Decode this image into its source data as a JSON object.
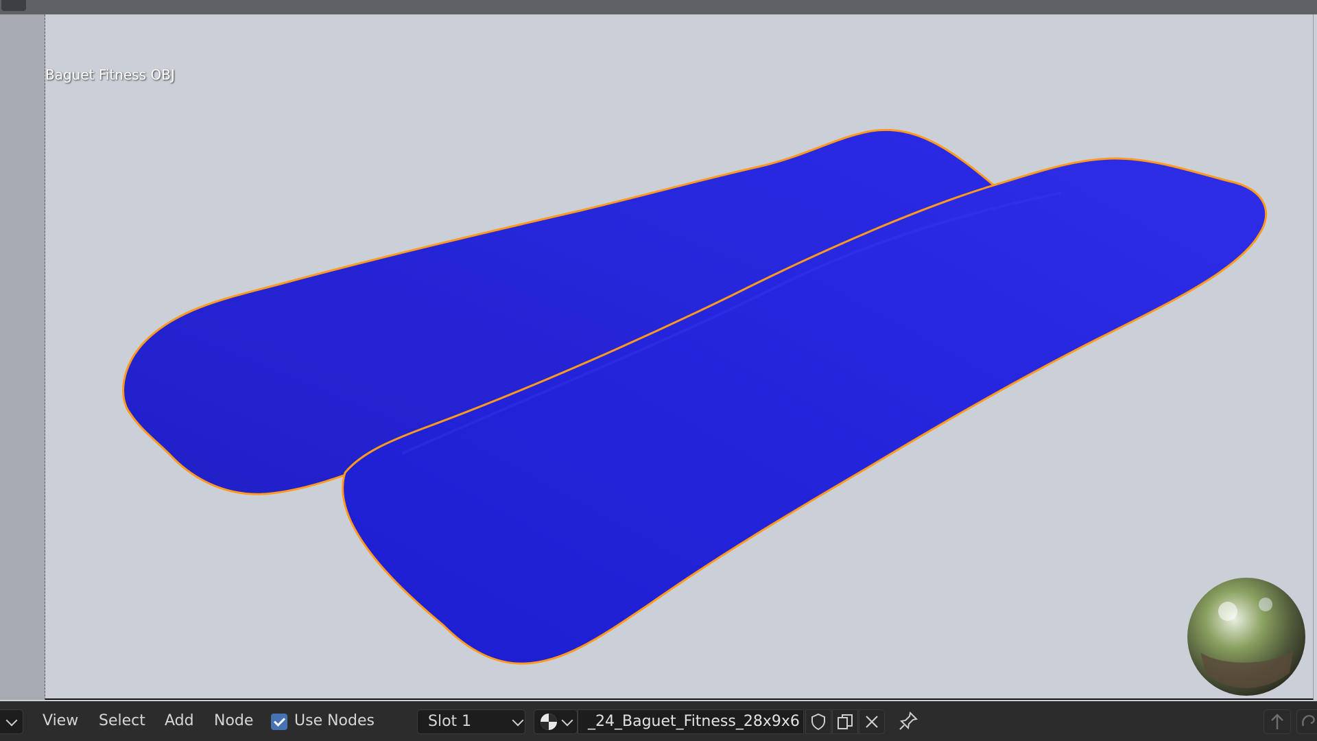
{
  "viewport": {
    "object_label": "Baguet Fitness OBJ",
    "object_color": "#2222dd",
    "outline_color": "#ff9a1f",
    "background_color": "#cbd0d8"
  },
  "header": {
    "menus": [
      "View",
      "Select",
      "Add",
      "Node"
    ],
    "use_nodes": {
      "label": "Use Nodes",
      "checked": true
    },
    "slot": {
      "selected": "Slot 1"
    },
    "material": {
      "icon": "material-sphere-icon",
      "name": "_24_Baguet_Fitness_28x9x6"
    },
    "icons": {
      "editor_type": "chevron-down-icon",
      "fake_user": "shield-icon",
      "duplicate": "duplicate-icon",
      "unlink": "close-icon",
      "pin": "pin-icon",
      "up": "arrow-up-icon",
      "help": "swirl-icon"
    }
  }
}
